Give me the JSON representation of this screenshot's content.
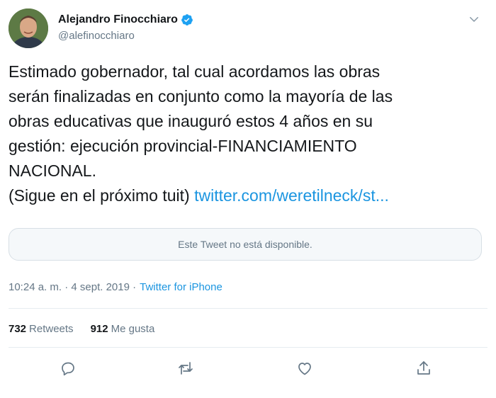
{
  "author": {
    "name": "Alejandro Finocchiaro",
    "handle": "@alefinocchiaro",
    "verified": true
  },
  "tweet": {
    "lines": [
      "Estimado gobernador, tal cual acordamos las obras",
      "serán finalizadas en conjunto como la mayoría de las",
      "obras educativas que inauguró estos 4 años en su",
      "gestión: ejecución provincial-FINANCIAMIENTO",
      "NACIONAL."
    ],
    "last_line_prefix": "(Sigue en el próximo tuit) ",
    "link_text": "twitter.com/weretilneck/st..."
  },
  "quoted": {
    "unavailable_text": "Este Tweet no está disponible."
  },
  "meta": {
    "time": "10:24 a. m. · 4 sept. 2019 ·",
    "source": "Twitter for iPhone"
  },
  "stats": {
    "retweets_count": "732",
    "retweets_label": "Retweets",
    "likes_count": "912",
    "likes_label": "Me gusta"
  },
  "colors": {
    "link": "#1b95e0",
    "muted": "#657786",
    "border": "#e6ecf0"
  },
  "icons": [
    "verified-badge-icon",
    "chevron-down-icon",
    "reply-icon",
    "retweet-icon",
    "like-icon",
    "share-icon"
  ]
}
